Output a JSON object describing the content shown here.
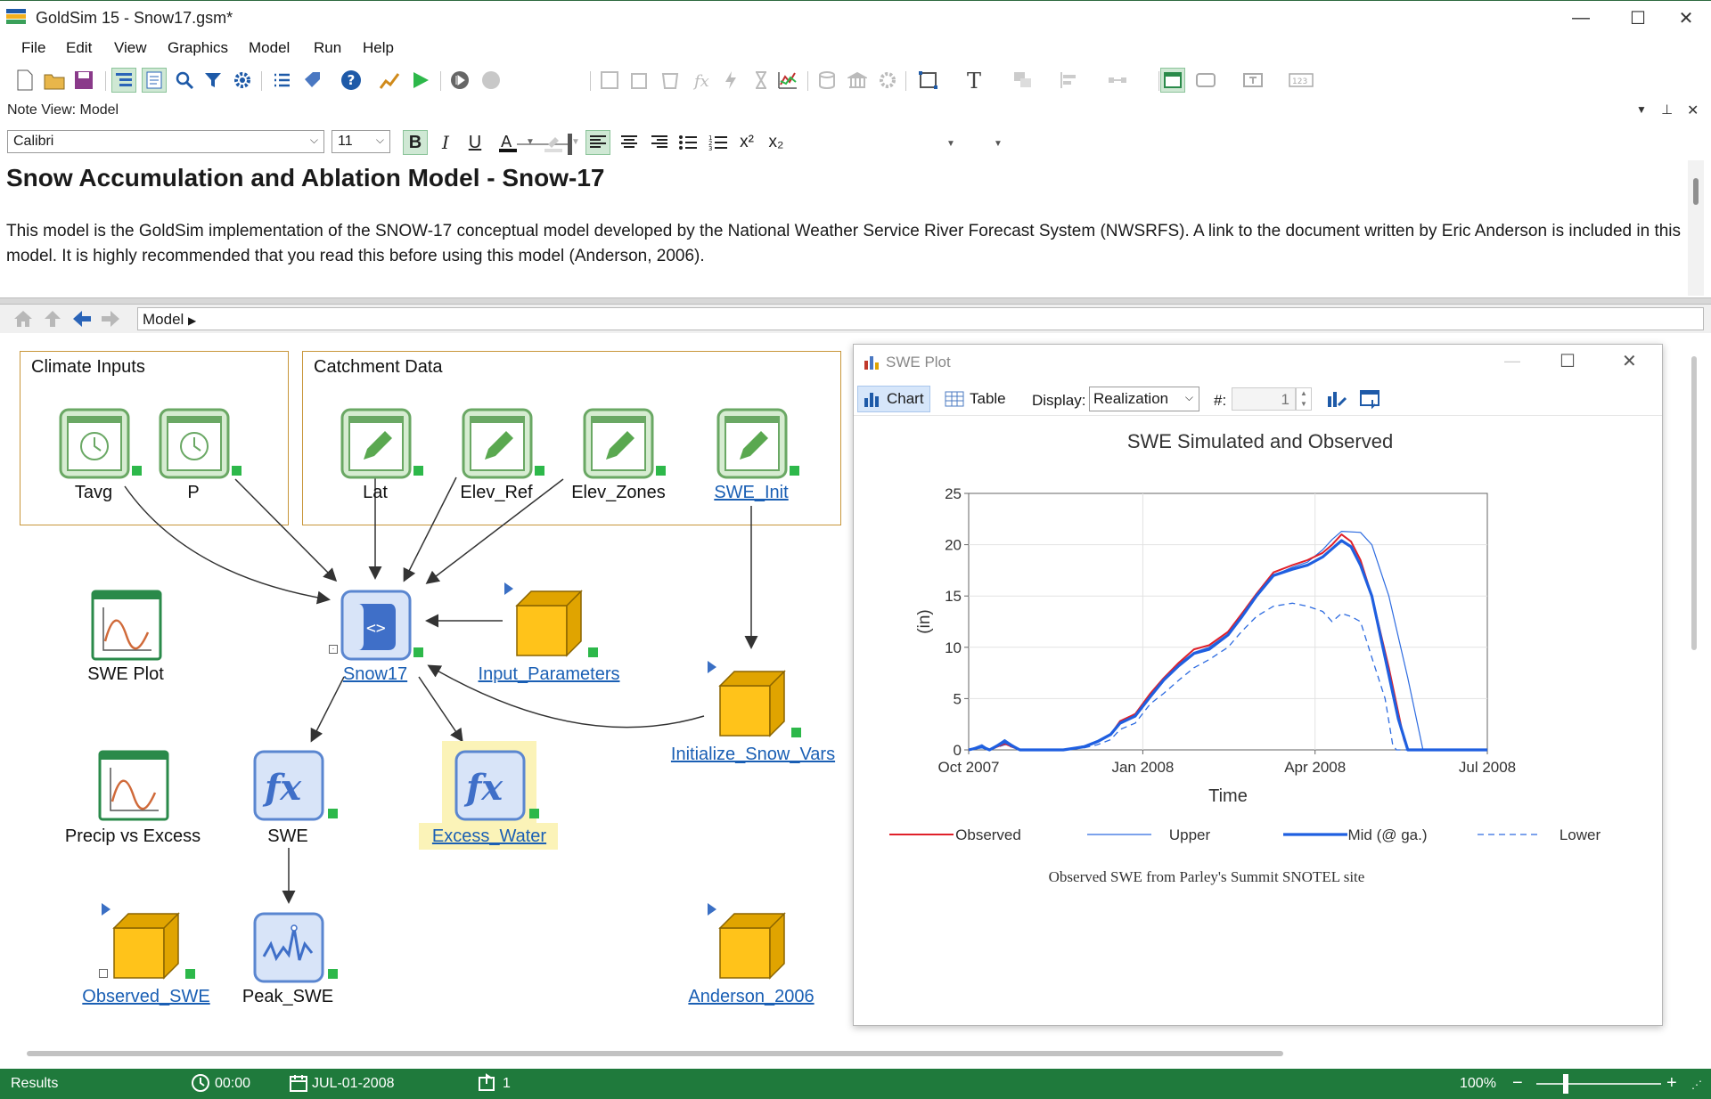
{
  "window": {
    "title": "GoldSim 15  - Snow17.gsm*",
    "minimize": "—",
    "maximize": "☐",
    "close": "✕"
  },
  "menu": [
    "File",
    "Edit",
    "View",
    "Graphics",
    "Model",
    "Run",
    "Help"
  ],
  "note_view": {
    "header": "Note View: Model",
    "font_name": "Calibri",
    "font_size": "11",
    "heading": "Snow Accumulation and Ablation Model - Snow-17",
    "body": "This model is the GoldSim implementation of the SNOW-17 conceptual model developed by the National Weather Service River Forecast System (NWSRFS). A link to the document written by Eric Anderson is included in this model. It is highly recommended that you read this before using this model (Anderson, 2006)."
  },
  "nav": {
    "path": "Model"
  },
  "groups": {
    "climate": "Climate Inputs",
    "catchment": "Catchment Data"
  },
  "elements": {
    "tavg": "Tavg",
    "p": "P",
    "lat": "Lat",
    "elev_ref": "Elev_Ref",
    "elev_zones": "Elev_Zones",
    "swe_init": "SWE_Init",
    "swe_plot": "SWE Plot",
    "snow17": "Snow17",
    "input_parameters": "Input_Parameters",
    "initialize_snow_vars": "Initialize_Snow_Vars",
    "precip_vs_excess": "Precip vs Excess",
    "swe": "SWE",
    "excess_water": "Excess_Water",
    "observed_swe": "Observed_SWE",
    "peak_swe": "Peak_SWE",
    "anderson_2006": "Anderson_2006"
  },
  "plot_window": {
    "title": "SWE Plot",
    "tab_chart": "Chart",
    "tab_table": "Table",
    "display_label": "Display:",
    "display_value": "Realization",
    "num_label": "#:",
    "num_value": "1"
  },
  "chart_data": {
    "type": "line",
    "title": "SWE Simulated and Observed",
    "xlabel": "Time",
    "ylabel": "(in)",
    "ylim": [
      0,
      25
    ],
    "yticks": [
      0,
      5,
      10,
      15,
      20,
      25
    ],
    "xticks": [
      "Oct 2007",
      "Jan 2008",
      "Apr 2008",
      "Jul 2008"
    ],
    "xrange": [
      "2007-10-01",
      "2008-07-01"
    ],
    "grid": true,
    "legend_position": "bottom",
    "caption": "Observed SWE from Parley's Summit SNOTEL site",
    "series": [
      {
        "name": "Observed",
        "color": "#e0202a",
        "style": "solid",
        "points": [
          [
            "2007-10-01",
            0
          ],
          [
            "2007-10-08",
            0.3
          ],
          [
            "2007-10-12",
            0
          ],
          [
            "2007-10-20",
            0.6
          ],
          [
            "2007-10-28",
            0
          ],
          [
            "2007-11-20",
            0
          ],
          [
            "2007-12-01",
            0.3
          ],
          [
            "2007-12-08",
            0.8
          ],
          [
            "2007-12-15",
            1.5
          ],
          [
            "2007-12-20",
            2.8
          ],
          [
            "2007-12-28",
            3.5
          ],
          [
            "2008-01-05",
            5.5
          ],
          [
            "2008-01-12",
            7.0
          ],
          [
            "2008-01-20",
            8.5
          ],
          [
            "2008-01-28",
            9.8
          ],
          [
            "2008-02-05",
            10.2
          ],
          [
            "2008-02-15",
            11.5
          ],
          [
            "2008-02-22",
            13.2
          ],
          [
            "2008-03-01",
            15.2
          ],
          [
            "2008-03-10",
            17.3
          ],
          [
            "2008-03-20",
            18.0
          ],
          [
            "2008-03-28",
            18.5
          ],
          [
            "2008-04-05",
            19.2
          ],
          [
            "2008-04-10",
            20.0
          ],
          [
            "2008-04-15",
            21.0
          ],
          [
            "2008-04-20",
            20.3
          ],
          [
            "2008-04-25",
            18.5
          ],
          [
            "2008-05-01",
            15.0
          ],
          [
            "2008-05-10",
            8.0
          ],
          [
            "2008-05-18",
            1.0
          ],
          [
            "2008-05-20",
            0
          ],
          [
            "2008-07-01",
            0
          ]
        ]
      },
      {
        "name": "Upper",
        "color": "#2d6be0",
        "style": "thin",
        "points": [
          [
            "2007-10-01",
            0
          ],
          [
            "2007-10-08",
            0.5
          ],
          [
            "2007-10-12",
            0
          ],
          [
            "2007-10-20",
            1.0
          ],
          [
            "2007-10-28",
            0
          ],
          [
            "2007-11-20",
            0
          ],
          [
            "2007-12-01",
            0.4
          ],
          [
            "2007-12-08",
            0.9
          ],
          [
            "2007-12-15",
            1.6
          ],
          [
            "2007-12-20",
            2.7
          ],
          [
            "2007-12-28",
            3.4
          ],
          [
            "2008-01-05",
            5.3
          ],
          [
            "2008-01-12",
            6.9
          ],
          [
            "2008-01-20",
            8.4
          ],
          [
            "2008-01-28",
            9.5
          ],
          [
            "2008-02-05",
            10.0
          ],
          [
            "2008-02-15",
            11.3
          ],
          [
            "2008-02-22",
            13.0
          ],
          [
            "2008-03-01",
            15.0
          ],
          [
            "2008-03-10",
            17.0
          ],
          [
            "2008-03-20",
            17.8
          ],
          [
            "2008-03-28",
            18.3
          ],
          [
            "2008-04-05",
            19.5
          ],
          [
            "2008-04-10",
            20.5
          ],
          [
            "2008-04-15",
            21.3
          ],
          [
            "2008-04-25",
            21.2
          ],
          [
            "2008-05-01",
            20.0
          ],
          [
            "2008-05-10",
            15.0
          ],
          [
            "2008-05-20",
            7.0
          ],
          [
            "2008-05-28",
            0
          ],
          [
            "2008-07-01",
            0
          ]
        ]
      },
      {
        "name": "Mid (@ ga.)",
        "color": "#1f5fe0",
        "style": "thick",
        "points": [
          [
            "2007-10-01",
            0
          ],
          [
            "2007-10-08",
            0.3
          ],
          [
            "2007-10-12",
            0
          ],
          [
            "2007-10-20",
            0.8
          ],
          [
            "2007-10-28",
            0
          ],
          [
            "2007-11-20",
            0
          ],
          [
            "2007-12-01",
            0.3
          ],
          [
            "2007-12-08",
            0.8
          ],
          [
            "2007-12-15",
            1.5
          ],
          [
            "2007-12-20",
            2.6
          ],
          [
            "2007-12-28",
            3.3
          ],
          [
            "2008-01-05",
            5.2
          ],
          [
            "2008-01-12",
            6.8
          ],
          [
            "2008-01-20",
            8.2
          ],
          [
            "2008-01-28",
            9.4
          ],
          [
            "2008-02-05",
            9.8
          ],
          [
            "2008-02-15",
            11.2
          ],
          [
            "2008-02-22",
            12.9
          ],
          [
            "2008-03-01",
            15.0
          ],
          [
            "2008-03-10",
            17.0
          ],
          [
            "2008-03-20",
            17.6
          ],
          [
            "2008-03-28",
            18.0
          ],
          [
            "2008-04-05",
            18.8
          ],
          [
            "2008-04-10",
            19.6
          ],
          [
            "2008-04-15",
            20.4
          ],
          [
            "2008-04-20",
            19.8
          ],
          [
            "2008-04-25",
            18.0
          ],
          [
            "2008-05-01",
            15.0
          ],
          [
            "2008-05-08",
            9.0
          ],
          [
            "2008-05-15",
            3.0
          ],
          [
            "2008-05-20",
            0
          ],
          [
            "2008-07-01",
            0
          ]
        ]
      },
      {
        "name": "Lower",
        "color": "#2d6be0",
        "style": "dashed",
        "points": [
          [
            "2007-10-01",
            0
          ],
          [
            "2007-10-08",
            0.2
          ],
          [
            "2007-10-12",
            0
          ],
          [
            "2007-10-20",
            0.5
          ],
          [
            "2007-10-28",
            0
          ],
          [
            "2007-11-20",
            0
          ],
          [
            "2007-12-01",
            0.2
          ],
          [
            "2007-12-08",
            0.5
          ],
          [
            "2007-12-15",
            1.0
          ],
          [
            "2007-12-20",
            2.0
          ],
          [
            "2007-12-28",
            2.6
          ],
          [
            "2008-01-05",
            4.5
          ],
          [
            "2008-01-12",
            5.5
          ],
          [
            "2008-01-20",
            6.8
          ],
          [
            "2008-01-28",
            8.0
          ],
          [
            "2008-02-05",
            8.8
          ],
          [
            "2008-02-15",
            10.0
          ],
          [
            "2008-02-22",
            11.5
          ],
          [
            "2008-03-01",
            13.0
          ],
          [
            "2008-03-10",
            14.0
          ],
          [
            "2008-03-20",
            14.3
          ],
          [
            "2008-03-28",
            14.0
          ],
          [
            "2008-04-05",
            13.5
          ],
          [
            "2008-04-10",
            12.5
          ],
          [
            "2008-04-15",
            13.3
          ],
          [
            "2008-04-20",
            13.0
          ],
          [
            "2008-04-25",
            12.5
          ],
          [
            "2008-05-01",
            9.0
          ],
          [
            "2008-05-08",
            5.0
          ],
          [
            "2008-05-12",
            0.5
          ],
          [
            "2008-05-14",
            0
          ],
          [
            "2008-07-01",
            0
          ]
        ]
      }
    ]
  },
  "status": {
    "mode": "Results",
    "time": "00:00",
    "date": "JUL-01-2008",
    "realization": "1",
    "zoom": "100%",
    "zoom_minus": "−",
    "zoom_plus": "+"
  }
}
